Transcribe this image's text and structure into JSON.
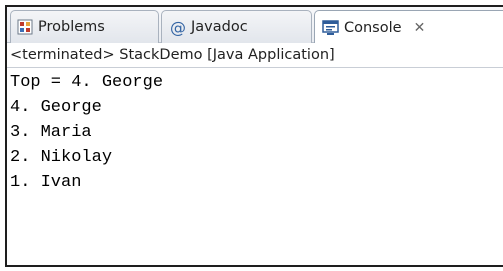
{
  "tabs": {
    "problems": {
      "label": "Problems",
      "icon": "problems-icon"
    },
    "javadoc": {
      "label": "Javadoc",
      "icon": "at-sign-icon",
      "glyph": "@"
    },
    "console": {
      "label": "Console",
      "icon": "console-icon",
      "close": "✕"
    }
  },
  "status": {
    "text": "<terminated> StackDemo [Java Application]"
  },
  "console": {
    "lines": [
      "Top = 4. George",
      "4. George",
      "3. Maria",
      "2. Nikolay",
      "1. Ivan"
    ]
  },
  "colors": {
    "accent": "#3465a4",
    "problems_icon_red": "#c0392b",
    "tabbar_bg": "#e9ecf1"
  }
}
